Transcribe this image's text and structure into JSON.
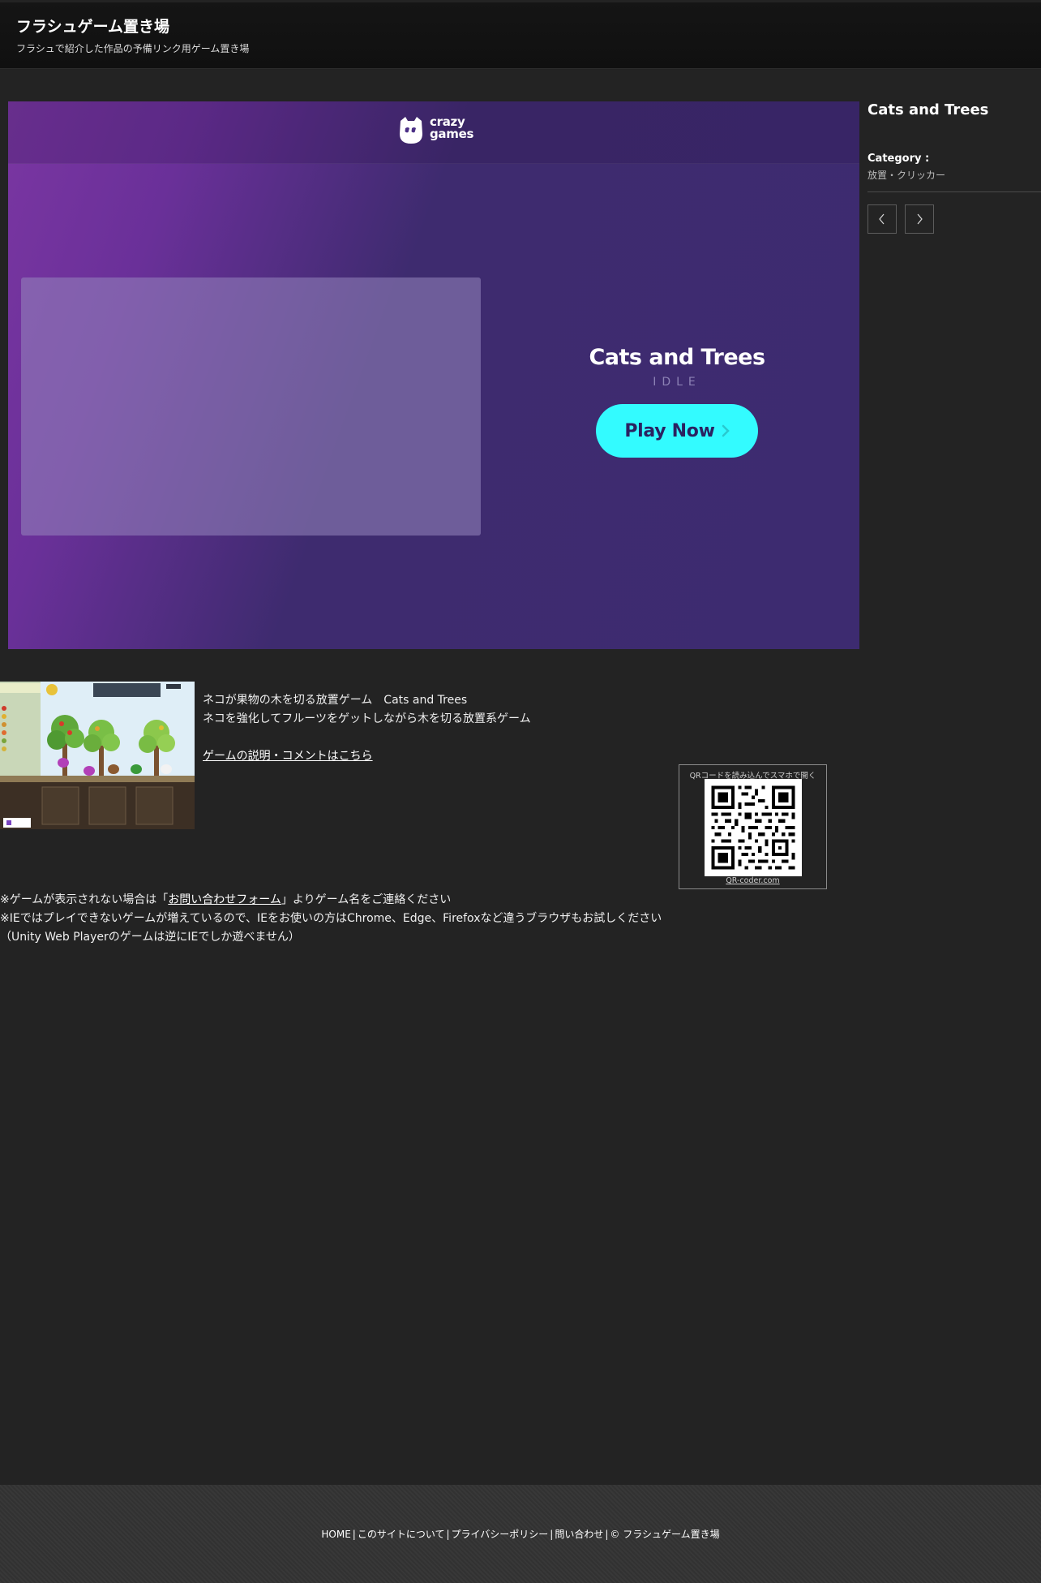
{
  "site": {
    "title": "フラシュゲーム置き場",
    "subtitle": "フラシュで紹介した作品の予備リンク用ゲーム置き場"
  },
  "game_frame": {
    "brand_line1": "crazy",
    "brand_line2": "games",
    "game_title": "Cats and Trees",
    "genre": "IDLE",
    "play_label": "Play Now",
    "accent_color": "#33fbff",
    "bg_color": "#3d2b70"
  },
  "sidebar": {
    "title": "Cats and Trees",
    "category_label": "Category :",
    "category_value": "放置・クリッカー"
  },
  "description": {
    "line1": "ネコが果物の木を切る放置ゲーム　Cats and Trees",
    "line2": "ネコを強化してフルーツをゲットしながら木を切る放置系ゲーム",
    "link": "ゲームの説明・コメントはこちら"
  },
  "qr": {
    "caption": "QRコードを読み込んでスマホで開く",
    "link": "QR-coder.com"
  },
  "notes": {
    "line1_before": "※ゲームが表示されない場合は「",
    "line1_link": "お問い合わせフォーム",
    "line1_after": "」よりゲーム名をご連絡ください",
    "line2": "※IEではプレイできないゲームが増えているので、IEをお使いの方はChrome、Edge、Firefoxなど違うブラウザもお試しください",
    "line3": "（Unity Web Playerのゲームは逆にIEでしか遊べません）"
  },
  "footer": {
    "home": "HOME",
    "about": "このサイトについて",
    "privacy": "プライバシーポリシー",
    "contact": "問い合わせ",
    "copyright": "© フラシュゲーム置き場"
  }
}
